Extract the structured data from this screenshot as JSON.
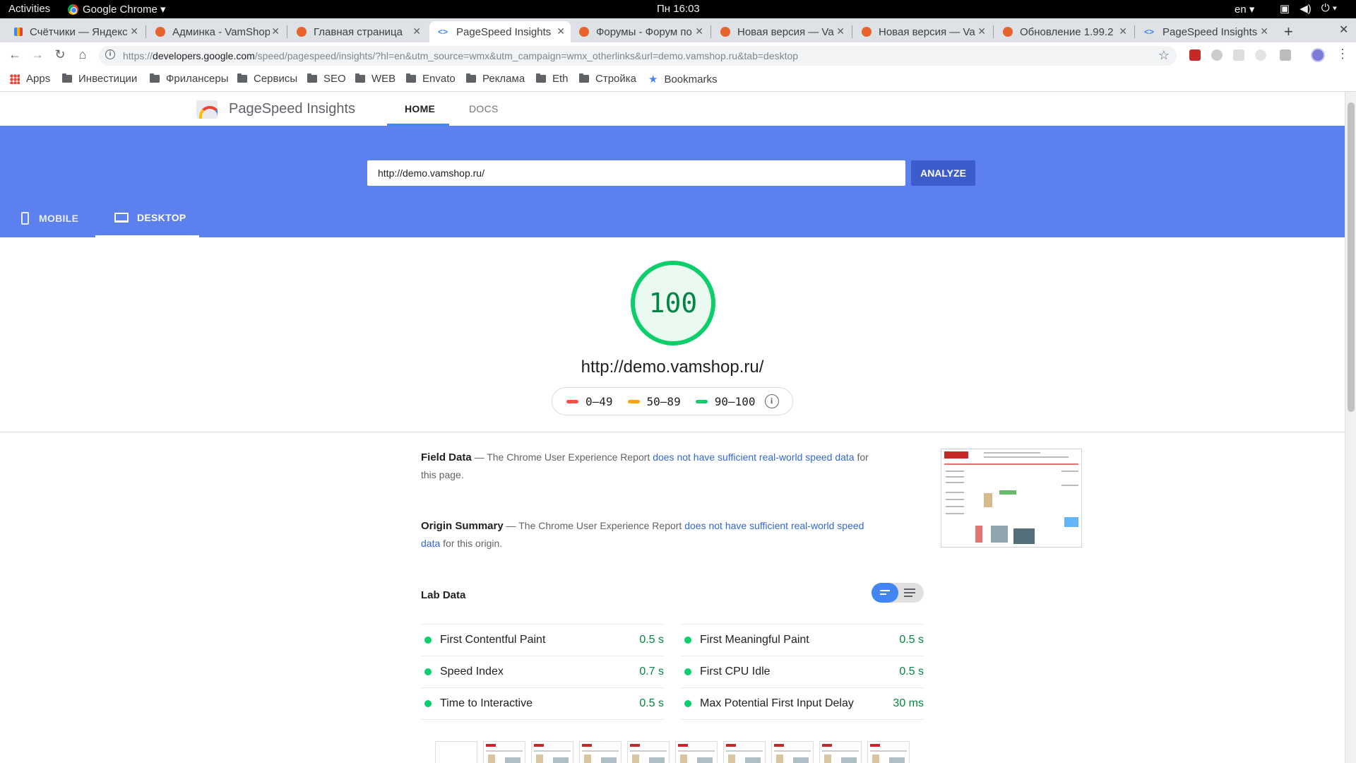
{
  "system_bar": {
    "activities": "Activities",
    "app_name": "Google Chrome ▾",
    "clock": "Пн 16:03",
    "lang": "en ▾",
    "tray_icons": [
      "window-icon",
      "volume-icon",
      "power-icon"
    ]
  },
  "tabs": [
    {
      "title": "Счётчики — Яндекс",
      "icon": "yandex-favicon"
    },
    {
      "title": "Админка - VamShop",
      "icon": "vamshop-favicon"
    },
    {
      "title": "Главная страница",
      "icon": "vamshop-favicon"
    },
    {
      "title": "PageSpeed Insights",
      "icon": "pagespeed-favicon",
      "active": true
    },
    {
      "title": "Форумы - Форум по",
      "icon": "vamshop-favicon"
    },
    {
      "title": "Новая версия — Va",
      "icon": "vamshop-favicon"
    },
    {
      "title": "Новая версия — Va",
      "icon": "vamshop-favicon"
    },
    {
      "title": "Обновление 1.99.2",
      "icon": "vamshop-favicon"
    },
    {
      "title": "PageSpeed Insights",
      "icon": "pagespeed-favicon"
    }
  ],
  "omnibox": {
    "scheme": "https://",
    "host": "developers.google.com",
    "path": "/speed/pagespeed/insights/?hl=en&utm_source=wmx&utm_campaign=wmx_otherlinks&url=demo.vamshop.ru&tab=desktop"
  },
  "bookmarks": [
    {
      "label": "Apps",
      "icon": "apps-grid-icon"
    },
    {
      "label": "Инвестиции",
      "icon": "folder-icon"
    },
    {
      "label": "Фрилансеры",
      "icon": "folder-icon"
    },
    {
      "label": "Сервисы",
      "icon": "folder-icon"
    },
    {
      "label": "SEO",
      "icon": "folder-icon"
    },
    {
      "label": "WEB",
      "icon": "folder-icon"
    },
    {
      "label": "Envato",
      "icon": "folder-icon"
    },
    {
      "label": "Реклама",
      "icon": "folder-icon"
    },
    {
      "label": "Eth",
      "icon": "folder-icon"
    },
    {
      "label": "Стройка",
      "icon": "folder-icon"
    },
    {
      "label": "Bookmarks",
      "icon": "star-icon"
    }
  ],
  "psi": {
    "title": "PageSpeed Insights",
    "nav": {
      "home": "HOME",
      "docs": "DOCS"
    },
    "input_value": "http://demo.vamshop.ru/",
    "analyze": "ANALYZE",
    "device_tabs": {
      "mobile": "MOBILE",
      "desktop": "DESKTOP"
    },
    "active_device": "desktop",
    "score": "100",
    "tested_url": "http://demo.vamshop.ru/",
    "legend": [
      {
        "range": "0–49",
        "color": "#ff4e42"
      },
      {
        "range": "50–89",
        "color": "#ffa400"
      },
      {
        "range": "90–100",
        "color": "#0cce6b"
      }
    ],
    "field_data": {
      "heading": "Field Data",
      "text_before": " — The Chrome User Experience Report ",
      "link": "does not have sufficient real-world speed data",
      "text_after": " for this page."
    },
    "origin_summary": {
      "heading": "Origin Summary",
      "text_before": " — The Chrome User Experience Report ",
      "link": "does not have sufficient real-world speed data",
      "text_after": " for this origin."
    },
    "lab_data_title": "Lab Data",
    "metrics": [
      {
        "name": "First Contentful Paint",
        "value": "0.5 s"
      },
      {
        "name": "First Meaningful Paint",
        "value": "0.5 s"
      },
      {
        "name": "Speed Index",
        "value": "0.7 s"
      },
      {
        "name": "First CPU Idle",
        "value": "0.5 s"
      },
      {
        "name": "Time to Interactive",
        "value": "0.5 s"
      },
      {
        "name": "Max Potential First Input Delay",
        "value": "30 ms"
      }
    ]
  },
  "colors": {
    "hero_blue": "#5c80ed",
    "analyze_blue": "#3d5ccc",
    "pass_green": "#0cce6b",
    "pass_text_green": "#018642",
    "link_blue": "#3367d6"
  }
}
